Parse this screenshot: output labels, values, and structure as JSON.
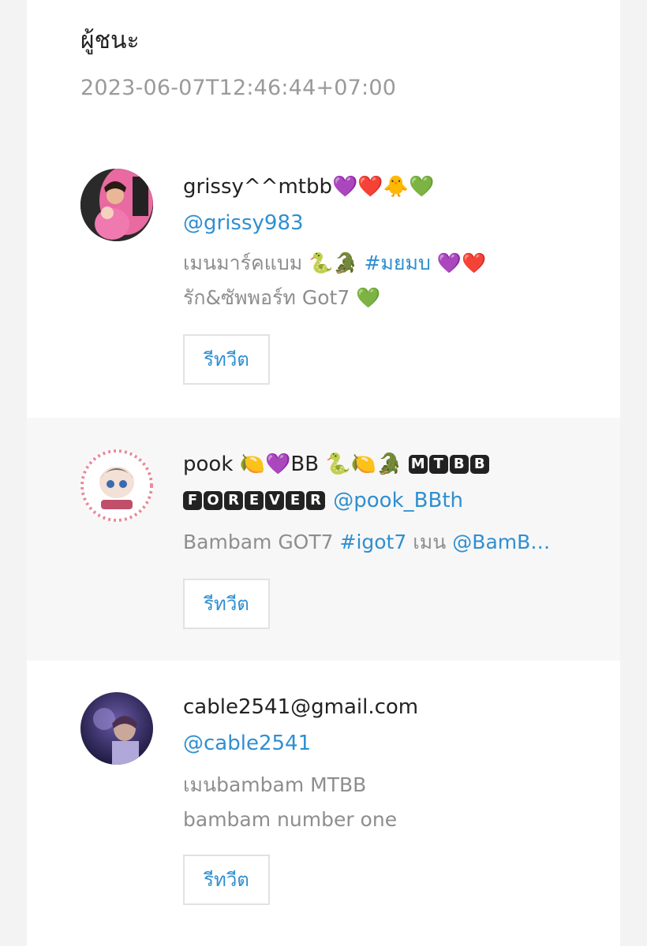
{
  "header": {
    "title": "ผู้ชนะ",
    "timestamp": "2023-06-07T12:46:44+07:00"
  },
  "winners": [
    {
      "display_name": "grissy^^mtbb",
      "name_emojis": [
        "💜",
        "❤️",
        "🐥",
        "💚"
      ],
      "handle": "@grissy983",
      "bio_line1_text": "เมนมาร์คแบม",
      "bio_line1_emojis": [
        "🐍",
        "🐊"
      ],
      "bio_line1_hashtag": "#มยมบ",
      "bio_line1_trailing_emojis": [
        "💜",
        "❤️"
      ],
      "bio_line2_text": "รัก&ซัพพอร์ท Got7",
      "bio_line2_emoji": "💚",
      "retweet_label": "รีทวีต"
    },
    {
      "display_name_prefix": "pook",
      "name_emojis": [
        "🍋",
        "💜"
      ],
      "display_name_mid": "BB",
      "name_emojis_2": [
        "🐍",
        "🍋",
        "🐊"
      ],
      "boxed_1": "MTBB",
      "boxed_2": "FOREVER",
      "handle": "@pook_BBth",
      "bio_text": "Bambam GOT7",
      "bio_hashtag": "#igot7",
      "bio_mid": "เมน",
      "bio_mention": "@BamB…",
      "retweet_label": "รีทวีต"
    },
    {
      "display_name": "cable2541@gmail.com",
      "handle": "@cable2541",
      "bio_line1": "เมนbambam MTBB",
      "bio_line2": "bambam number one",
      "retweet_label": "รีทวีต"
    }
  ]
}
